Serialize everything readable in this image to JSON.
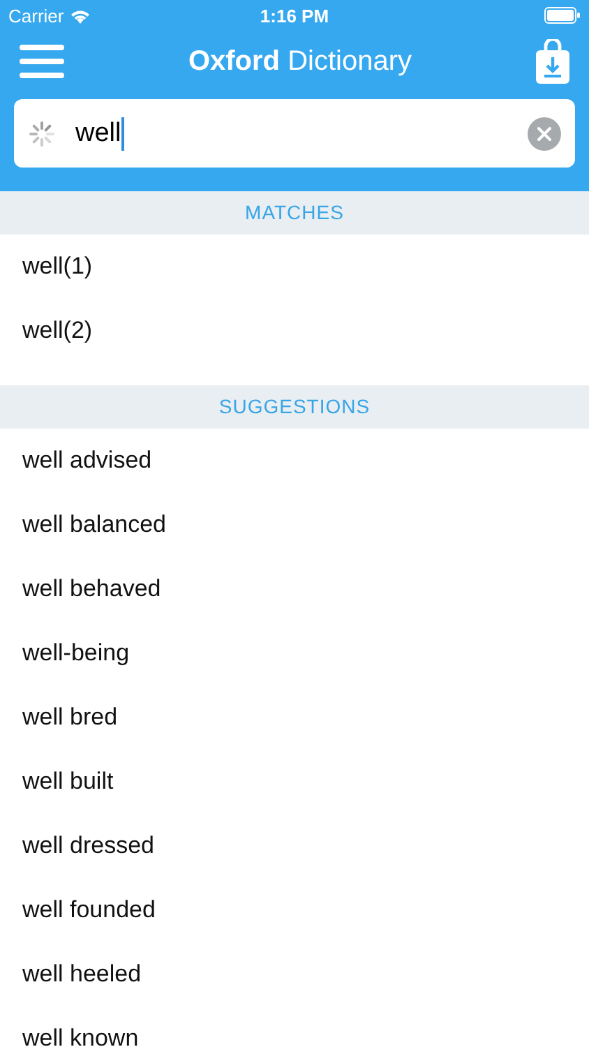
{
  "status_bar": {
    "carrier": "Carrier",
    "time": "1:16 PM"
  },
  "header": {
    "title": "**Oxford** Dictionary"
  },
  "search": {
    "value": "well",
    "loading": true
  },
  "sections": [
    {
      "title": "MATCHES",
      "items": [
        "well(1)",
        "well(2)"
      ]
    },
    {
      "title": "SUGGESTIONS",
      "items": [
        "well advised",
        "well balanced",
        "well behaved",
        "well-being",
        "well bred",
        "well built",
        "well dressed",
        "well founded",
        "well heeled",
        "well known"
      ]
    }
  ]
}
